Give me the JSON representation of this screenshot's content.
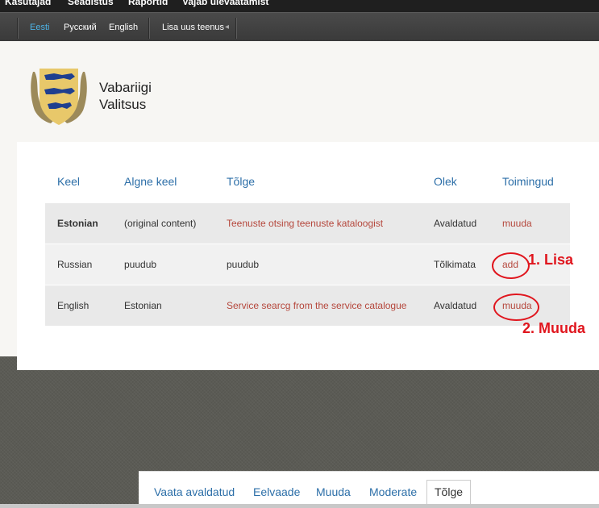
{
  "admin_bar": {
    "items": [
      "Kasutajad",
      "Seadistus",
      "Raportid",
      "Vajab ülevaatamist"
    ]
  },
  "sub_bar": {
    "languages": [
      "Eesti",
      "Русский",
      "English"
    ],
    "add_service": "Lisa uus teenus"
  },
  "site": {
    "name_line1": "Vabariigi",
    "name_line2": "Valitsus"
  },
  "translation_table": {
    "headers": [
      "Keel",
      "Algne keel",
      "Tõlge",
      "Olek",
      "Toimingud"
    ],
    "rows": [
      {
        "language": "Estonian",
        "source": "(original content)",
        "translation": "Teenuste otsing teenuste kataloogist",
        "status": "Avaldatud",
        "action": "muuda"
      },
      {
        "language": "Russian",
        "source": "puudub",
        "translation": "puudub",
        "status": "Tõlkimata",
        "action": "add"
      },
      {
        "language": "English",
        "source": "Estonian",
        "translation": "Service searcg from the service catalogue",
        "status": "Avaldatud",
        "action": "muuda"
      }
    ]
  },
  "annotations": {
    "label1": "1. Lisa",
    "label2": "2. Muuda",
    "color": "#e0161e"
  },
  "tabs": [
    "Vaata avaldatud",
    "Eelvaade",
    "Muuda",
    "Moderate",
    "Tõlge"
  ],
  "active_tab": "Tõlge",
  "colors": {
    "accent_link": "#2d6fa8",
    "active_language": "#4db3e6",
    "content_link": "#b5473c"
  }
}
